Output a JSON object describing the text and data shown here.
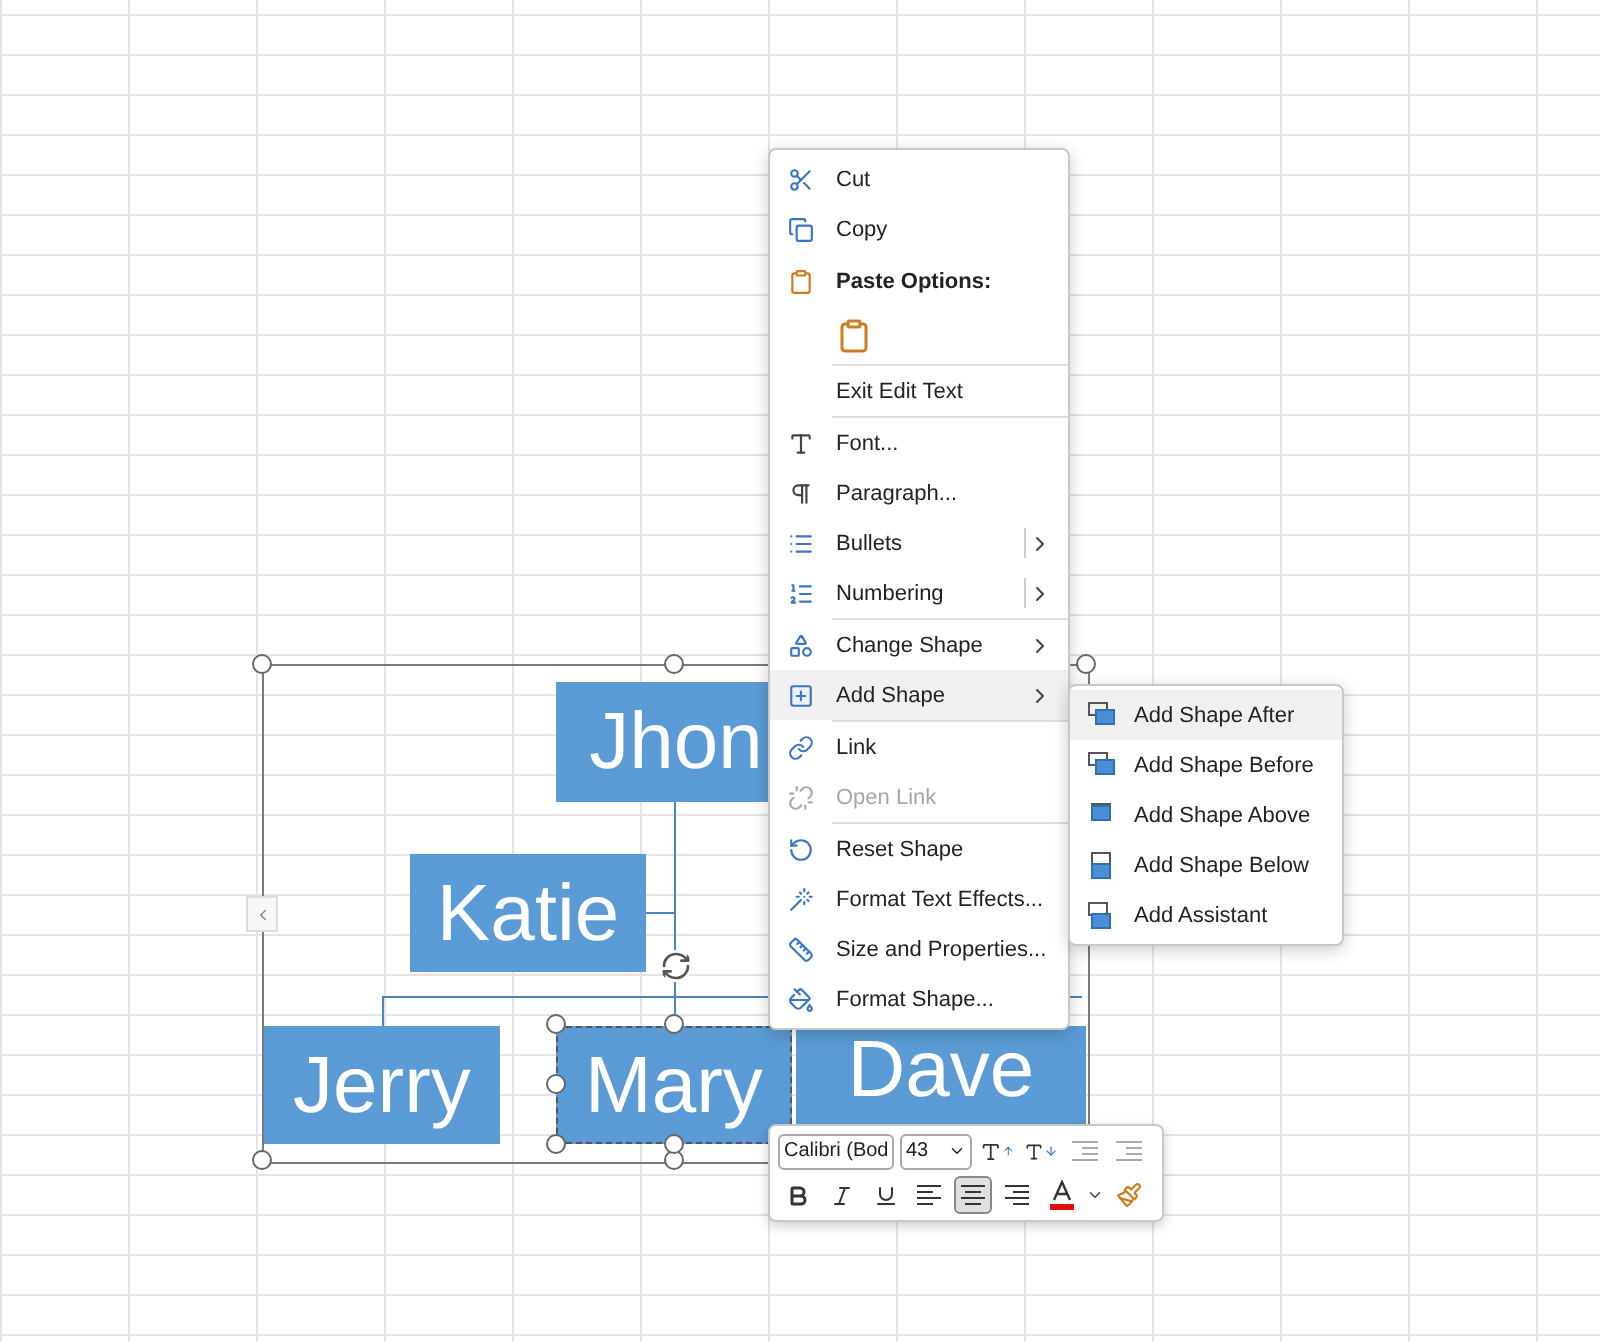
{
  "diagram": {
    "nodes": [
      {
        "label": "Jhon",
        "selected": false
      },
      {
        "label": "Katie",
        "selected": false
      },
      {
        "label": "Jerry",
        "selected": false
      },
      {
        "label": "Mary",
        "selected": true
      },
      {
        "label": "Dave",
        "selected": false
      }
    ]
  },
  "context_menu": {
    "items": [
      {
        "kind": "item",
        "label": "Cut"
      },
      {
        "kind": "item",
        "label": "Copy"
      },
      {
        "kind": "heading",
        "label": "Paste Options:"
      },
      {
        "kind": "paste"
      },
      {
        "kind": "item",
        "label": "Exit Edit Text",
        "divider": true
      },
      {
        "kind": "item",
        "label": "Font...",
        "divider": true
      },
      {
        "kind": "item",
        "label": "Paragraph..."
      },
      {
        "kind": "item",
        "label": "Bullets",
        "submenu": true,
        "split": true
      },
      {
        "kind": "item",
        "label": "Numbering",
        "submenu": true,
        "split": true
      },
      {
        "kind": "item",
        "label": "Change Shape",
        "submenu": true,
        "divider": true
      },
      {
        "kind": "item",
        "label": "Add Shape",
        "submenu": true,
        "selected": true
      },
      {
        "kind": "item",
        "label": "Link",
        "divider": true
      },
      {
        "kind": "item",
        "label": "Open Link",
        "disabled": true
      },
      {
        "kind": "item",
        "label": "Reset Shape",
        "divider": true
      },
      {
        "kind": "item",
        "label": "Format Text Effects..."
      },
      {
        "kind": "item",
        "label": "Size and Properties..."
      },
      {
        "kind": "item",
        "label": "Format Shape..."
      }
    ]
  },
  "submenu": {
    "items": [
      {
        "label": "Add Shape After",
        "selected": true
      },
      {
        "label": "Add Shape Before",
        "selected": false
      },
      {
        "label": "Add Shape Above",
        "selected": false
      },
      {
        "label": "Add Shape Below",
        "selected": false
      },
      {
        "label": "Add Assistant",
        "selected": false
      }
    ]
  },
  "mini_toolbar": {
    "font": "Calibri (Bod",
    "size": "43",
    "alignment": [
      {
        "selected": false
      },
      {
        "selected": true
      },
      {
        "selected": false
      }
    ]
  }
}
